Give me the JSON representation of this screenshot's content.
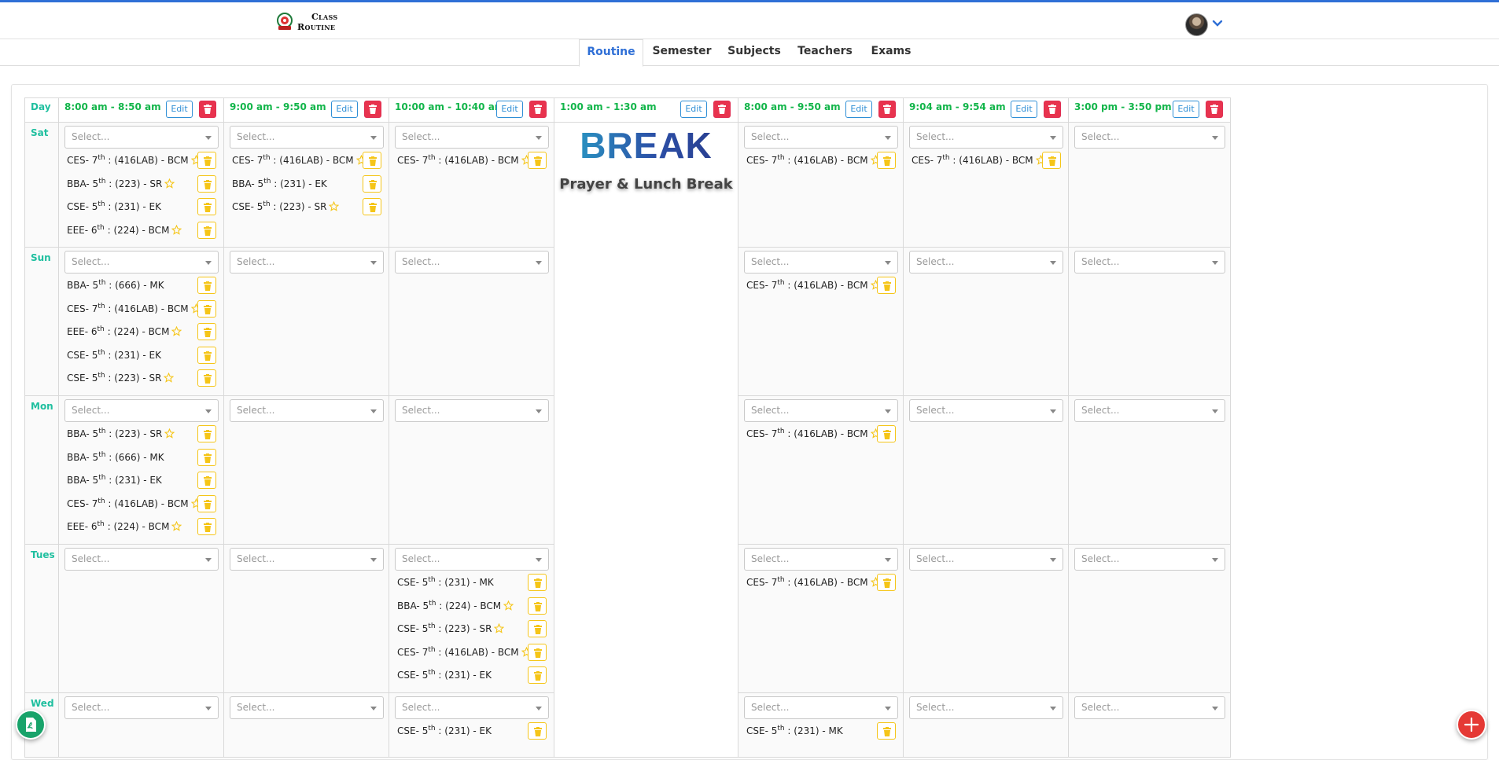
{
  "app": {
    "logo_line1": "Class",
    "logo_line2": "Routine"
  },
  "colors": {
    "accent": "#2f6fd6",
    "time_text": "#12b54a",
    "day_text": "#1fbf9f",
    "delete_button": "#e8334e",
    "entry_button": "#f5c518",
    "fab_left": "#18a36a",
    "fab_right": "#e53935"
  },
  "nav": {
    "tabs": [
      {
        "label": "Routine",
        "active": true
      },
      {
        "label": "Semester",
        "active": false
      },
      {
        "label": "Subjects",
        "active": false
      },
      {
        "label": "Teachers",
        "active": false
      },
      {
        "label": "Exams",
        "active": false
      }
    ]
  },
  "table": {
    "day_header": "Day",
    "edit_label": "Edit",
    "select_placeholder": "Select...",
    "columns": [
      {
        "time": "8:00 am - 8:50 am"
      },
      {
        "time": "9:00 am - 9:50 am"
      },
      {
        "time": "10:00 am - 10:40 am"
      },
      {
        "time": "1:00 am - 1:30 am",
        "is_break": true
      },
      {
        "time": "8:00 am - 9:50 am"
      },
      {
        "time": "9:04 am - 9:54 am"
      },
      {
        "time": "3:00 pm - 3:50 pm"
      }
    ],
    "break": {
      "title": "BREAK",
      "subtitle": "Prayer & Lunch Break"
    },
    "days": [
      {
        "name": "Sat",
        "cells": [
          [
            {
              "dept": "CES- 7",
              "ord": "th",
              "rest": " : (416LAB) - BCM",
              "star": true
            },
            {
              "dept": "BBA- 5",
              "ord": "th",
              "rest": " : (223) - SR",
              "star": true
            },
            {
              "dept": "CSE- 5",
              "ord": "th",
              "rest": " : (231) - EK",
              "star": false
            },
            {
              "dept": "EEE- 6",
              "ord": "th",
              "rest": " : (224) - BCM",
              "star": true
            }
          ],
          [
            {
              "dept": "CES- 7",
              "ord": "th",
              "rest": " : (416LAB) - BCM",
              "star": true
            },
            {
              "dept": "BBA- 5",
              "ord": "th",
              "rest": " : (231) - EK",
              "star": false
            },
            {
              "dept": "CSE- 5",
              "ord": "th",
              "rest": " : (223) - SR",
              "star": true
            }
          ],
          [
            {
              "dept": "CES- 7",
              "ord": "th",
              "rest": " : (416LAB) - BCM",
              "star": true
            }
          ],
          null,
          [
            {
              "dept": "CES- 7",
              "ord": "th",
              "rest": " : (416LAB) - BCM",
              "star": true
            }
          ],
          [
            {
              "dept": "CES- 7",
              "ord": "th",
              "rest": " : (416LAB) - BCM",
              "star": true
            }
          ],
          []
        ]
      },
      {
        "name": "Sun",
        "cells": [
          [
            {
              "dept": "BBA- 5",
              "ord": "th",
              "rest": " : (666) - MK",
              "star": false
            },
            {
              "dept": "CES- 7",
              "ord": "th",
              "rest": " : (416LAB) - BCM",
              "star": true
            },
            {
              "dept": "EEE- 6",
              "ord": "th",
              "rest": " : (224) - BCM",
              "star": true
            },
            {
              "dept": "CSE- 5",
              "ord": "th",
              "rest": " : (231) - EK",
              "star": false
            },
            {
              "dept": "CSE- 5",
              "ord": "th",
              "rest": " : (223) - SR",
              "star": true
            }
          ],
          [],
          [],
          null,
          [
            {
              "dept": "CES- 7",
              "ord": "th",
              "rest": " : (416LAB) - BCM",
              "star": true
            }
          ],
          [],
          []
        ]
      },
      {
        "name": "Mon",
        "cells": [
          [
            {
              "dept": "BBA- 5",
              "ord": "th",
              "rest": " : (223) - SR",
              "star": true
            },
            {
              "dept": "BBA- 5",
              "ord": "th",
              "rest": " : (666) - MK",
              "star": false
            },
            {
              "dept": "BBA- 5",
              "ord": "th",
              "rest": " : (231) - EK",
              "star": false
            },
            {
              "dept": "CES- 7",
              "ord": "th",
              "rest": " : (416LAB) - BCM",
              "star": true
            },
            {
              "dept": "EEE- 6",
              "ord": "th",
              "rest": " : (224) - BCM",
              "star": true
            }
          ],
          [],
          [],
          null,
          [
            {
              "dept": "CES- 7",
              "ord": "th",
              "rest": " : (416LAB) - BCM",
              "star": true
            }
          ],
          [],
          []
        ]
      },
      {
        "name": "Tues",
        "cells": [
          [],
          [],
          [
            {
              "dept": "CSE- 5",
              "ord": "th",
              "rest": " : (231) - MK",
              "star": false
            },
            {
              "dept": "BBA- 5",
              "ord": "th",
              "rest": " : (224) - BCM",
              "star": true
            },
            {
              "dept": "CSE- 5",
              "ord": "th",
              "rest": " : (223) - SR",
              "star": true
            },
            {
              "dept": "CES- 7",
              "ord": "th",
              "rest": " : (416LAB) - BCM",
              "star": true
            },
            {
              "dept": "CSE- 5",
              "ord": "th",
              "rest": " : (231) - EK",
              "star": false
            }
          ],
          null,
          [
            {
              "dept": "CES- 7",
              "ord": "th",
              "rest": " : (416LAB) - BCM",
              "star": true
            }
          ],
          [],
          []
        ]
      },
      {
        "name": "Wed",
        "cells": [
          [],
          [],
          [
            {
              "dept": "CSE- 5",
              "ord": "th",
              "rest": " : (231) - EK",
              "star": false
            }
          ],
          null,
          [
            {
              "dept": "CSE- 5",
              "ord": "th",
              "rest": " : (231) - MK",
              "star": false
            }
          ],
          [],
          []
        ]
      }
    ]
  }
}
